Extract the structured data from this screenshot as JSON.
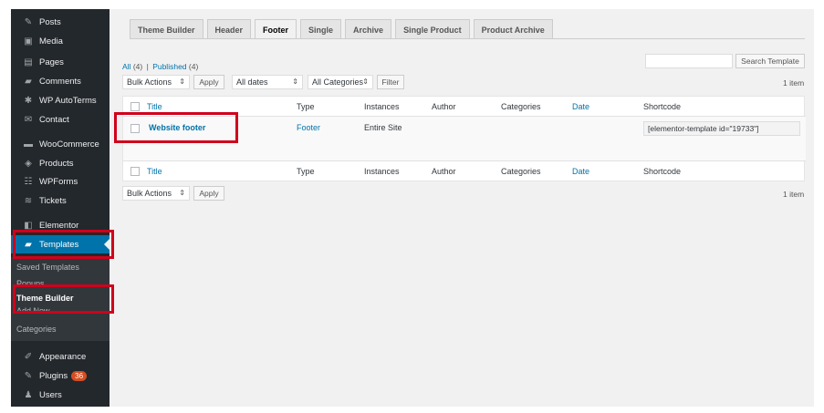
{
  "sidebar": {
    "items": [
      {
        "label": "Posts",
        "icon": "pin-icon"
      },
      {
        "label": "Media",
        "icon": "media-icon"
      },
      {
        "label": "Pages",
        "icon": "pages-icon"
      },
      {
        "label": "Comments",
        "icon": "comments-icon"
      },
      {
        "label": "WP AutoTerms",
        "icon": "autoterms-icon"
      },
      {
        "label": "Contact",
        "icon": "envelope-icon"
      },
      {
        "label": "WooCommerce",
        "icon": "woo-icon"
      },
      {
        "label": "Products",
        "icon": "products-icon"
      },
      {
        "label": "WPForms",
        "icon": "forms-icon"
      },
      {
        "label": "Tickets",
        "icon": "tickets-icon"
      },
      {
        "label": "Elementor",
        "icon": "elementor-icon"
      },
      {
        "label": "Templates",
        "icon": "folder-icon"
      },
      {
        "label": "Appearance",
        "icon": "brush-icon"
      },
      {
        "label": "Plugins",
        "icon": "plug-icon",
        "badge": "36"
      },
      {
        "label": "Users",
        "icon": "user-icon"
      }
    ],
    "submenu": [
      "Saved Templates",
      "Popups",
      "Theme Builder",
      "Add New",
      "Categories"
    ]
  },
  "tabs": [
    "Theme Builder",
    "Header",
    "Footer",
    "Single",
    "Archive",
    "Single Product",
    "Product Archive"
  ],
  "filters": {
    "all": "All",
    "all_count": "(4)",
    "separator": "|",
    "published": "Published",
    "published_count": "(4)"
  },
  "search": {
    "button": "Search Template",
    "placeholder": ""
  },
  "toolbar": {
    "bulk_actions": "Bulk Actions",
    "apply": "Apply",
    "dates": "All dates",
    "categories": "All Categories",
    "filter": "Filter",
    "items": "1 item"
  },
  "table": {
    "headers": [
      "Title",
      "Type",
      "Instances",
      "Author",
      "Categories",
      "Date",
      "Shortcode"
    ],
    "row": {
      "title": "Website footer",
      "type": "Footer",
      "instances": "Entire Site",
      "shortcode": "[elementor-template id=\"19733\"]"
    }
  },
  "colors": {
    "sidebar": "#23282d",
    "accent": "#0073aa",
    "highlight": "#d0021b",
    "badge": "#d54e21"
  }
}
